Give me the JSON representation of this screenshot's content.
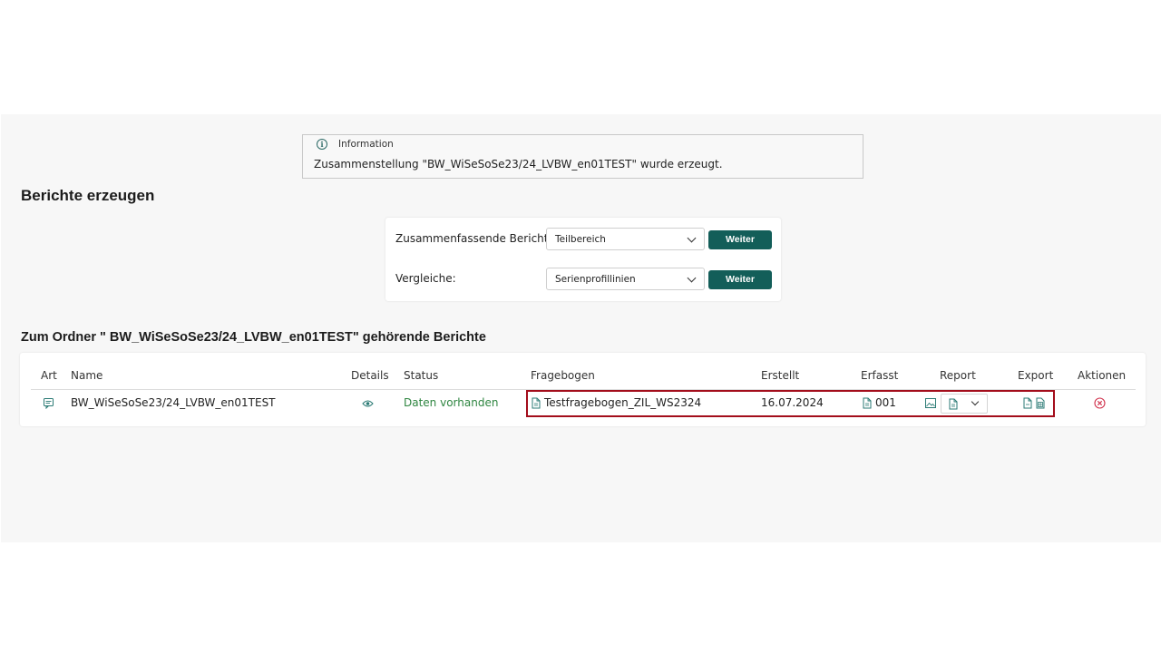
{
  "info": {
    "title": "Information",
    "message": "Zusammenstellung \"BW_WiSeSoSe23/24_LVBW_en01TEST\" wurde erzeugt."
  },
  "berichte": {
    "heading": "Berichte erzeugen",
    "rows": [
      {
        "label": "Zusammenfassende Berichte:",
        "selected": "Teilbereich",
        "button": "Weiter"
      },
      {
        "label": "Vergleiche:",
        "selected": "Serienprofillinien",
        "button": "Weiter"
      }
    ]
  },
  "ordner": {
    "heading": "Zum Ordner \" BW_WiSeSoSe23/24_LVBW_en01TEST\" gehörende Berichte"
  },
  "table": {
    "headers": {
      "art": "Art",
      "name": "Name",
      "details": "Details",
      "status": "Status",
      "fragebogen": "Fragebogen",
      "erstellt": "Erstellt",
      "erfasst": "Erfasst",
      "report": "Report",
      "export": "Export",
      "aktionen": "Aktionen"
    },
    "row": {
      "name": "BW_WiSeSoSe23/24_LVBW_en01TEST",
      "status": "Daten vorhanden",
      "fragebogen": "Testfragebogen_ZIL_WS2324",
      "erstellt": "16.07.2024",
      "erfasst": "001"
    }
  },
  "colors": {
    "accent": "#135e59",
    "status_ok": "#2e8540",
    "highlight": "#a30d1b",
    "delete": "#d0304b"
  },
  "icons": [
    "info-icon",
    "comment-icon",
    "eye-icon",
    "document-icon",
    "image-icon",
    "chevron-down-icon",
    "delete-icon"
  ]
}
